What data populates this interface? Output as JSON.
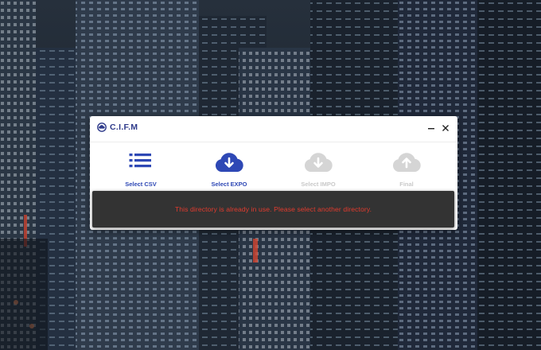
{
  "app": {
    "title": "C.I.F.M"
  },
  "window_controls": {
    "minimize": "minimize-icon",
    "close": "close-icon"
  },
  "steps": [
    {
      "label": "Select CSV",
      "icon": "list-icon",
      "state": "active"
    },
    {
      "label": "Select EXPO",
      "icon": "cloud-download-icon",
      "state": "active"
    },
    {
      "label": "Select IMPO",
      "icon": "cloud-download-icon",
      "state": "disabled"
    },
    {
      "label": "Final",
      "icon": "cloud-upload-icon",
      "state": "disabled"
    }
  ],
  "toast": {
    "message": "This directory is already in use. Please select another directory."
  },
  "colors": {
    "accent": "#2e48b5",
    "disabled": "#d5d5d5",
    "toast_bg": "#333333",
    "toast_text": "#e23b2e",
    "background": "#1c2430"
  }
}
